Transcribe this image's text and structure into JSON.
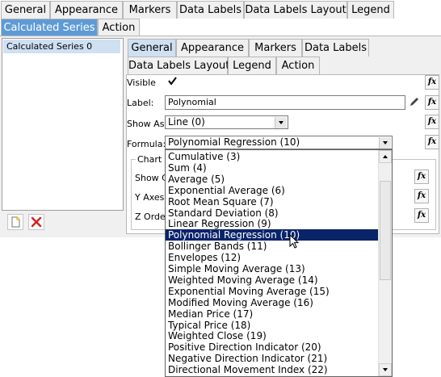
{
  "outer_tabs_row1": [
    "General",
    "Appearance",
    "Markers",
    "Data Labels",
    "Data Labels Layout",
    "Legend"
  ],
  "outer_tabs_row2": [
    "Calculated Series",
    "Action"
  ],
  "inner_tabs_row1": [
    "General",
    "Appearance",
    "Markers",
    "Data Labels"
  ],
  "inner_tabs_row2": [
    "Data Labels Layout",
    "Legend",
    "Action"
  ],
  "series_list": [
    "Calculated Series 0"
  ],
  "form": {
    "visible_label": "Visible",
    "visible_checked": true,
    "label_label": "Label:",
    "label_value": "Polynomial",
    "show_as_label": "Show As:",
    "show_as_value": "Line (0)",
    "formula_label": "Formula:",
    "formula_value": "Polynomial Regression (10)",
    "group_title": "Chart A",
    "show_label": "Show C",
    "y_axes_label": "Y Axes:",
    "z_order_label": "Z Order"
  },
  "fx_label": "fx",
  "dropdown_items": [
    "Cumulative (3)",
    "Sum (4)",
    "Average (5)",
    "Exponential Average (6)",
    "Root Mean Square (7)",
    "Standard Deviation (8)",
    "Linear Regression (9)",
    "Polynomial Regression (10)",
    "Bollinger Bands (11)",
    "Envelopes (12)",
    "Simple Moving Average (13)",
    "Weighted Moving Average (14)",
    "Exponential Moving Average (15)",
    "Modified Moving Average (16)",
    "Median Price (17)",
    "Typical Price (18)",
    "Weighted Close (19)",
    "Positive Direction Indicator (20)",
    "Negative Direction Indicator (21)",
    "Directional Movement Index (22)"
  ],
  "selected_index": 7,
  "colors": {
    "active_tab": "#5e9bd6",
    "selection": "#0a246a",
    "panel": "#f0f0f0"
  }
}
